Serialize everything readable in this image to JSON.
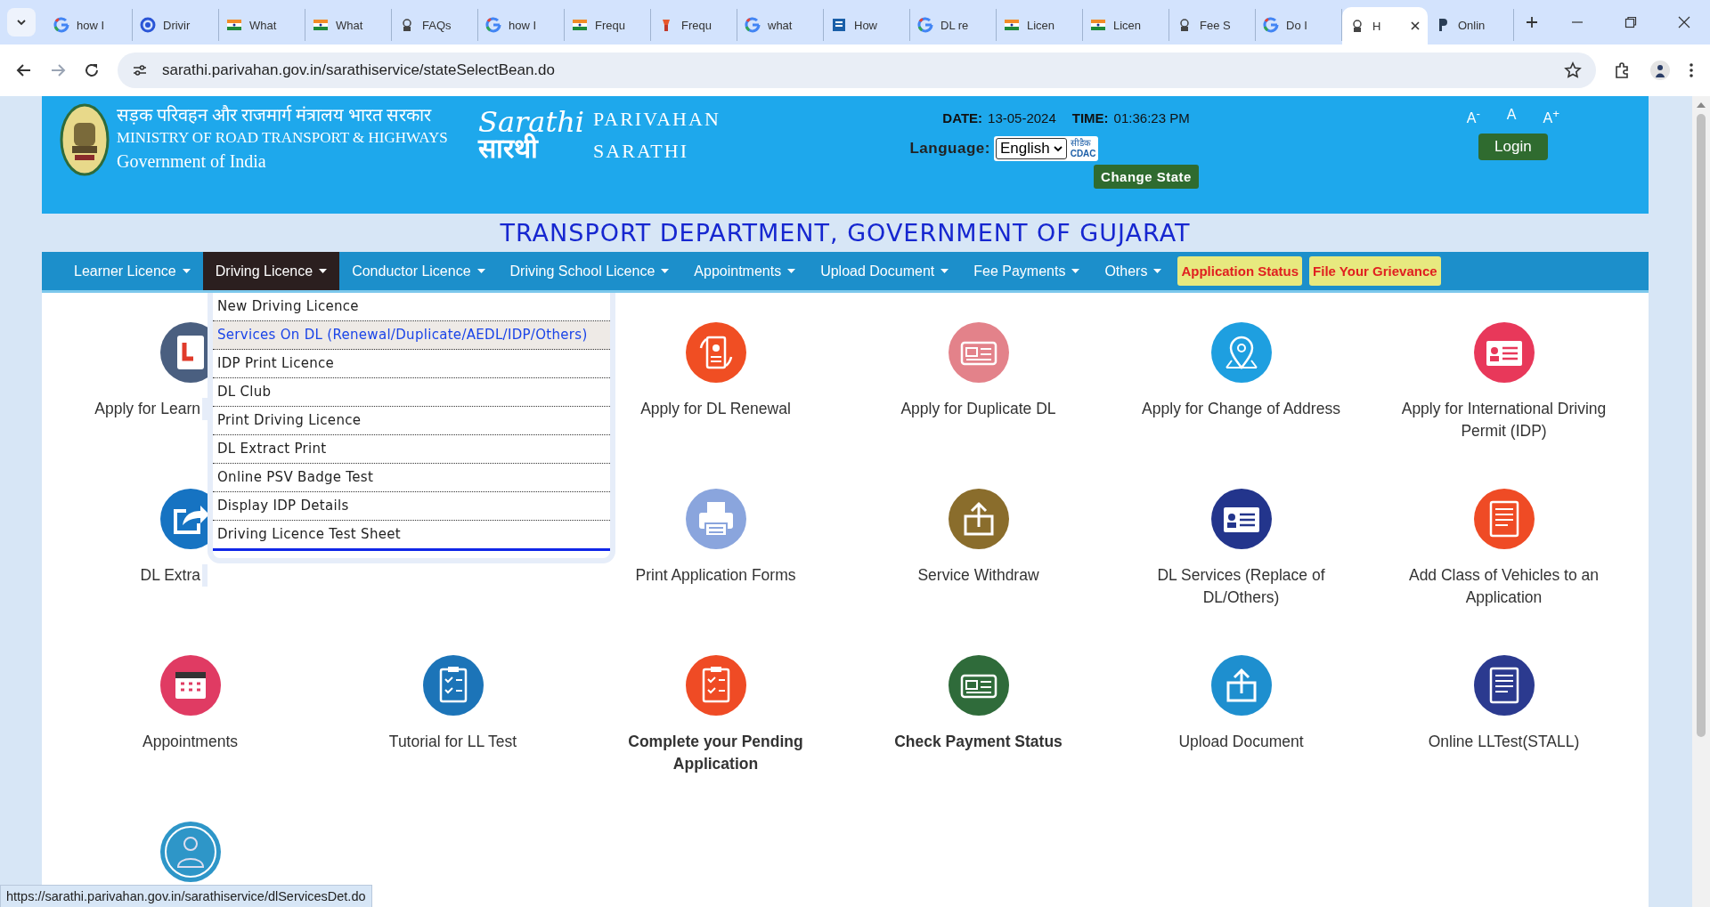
{
  "browser": {
    "tabs": [
      {
        "kind": "google",
        "title": "how I",
        "selected": false
      },
      {
        "kind": "ring",
        "title": "Drivir",
        "selected": false
      },
      {
        "kind": "flag",
        "title": "What",
        "selected": false
      },
      {
        "kind": "flag",
        "title": "What",
        "selected": false
      },
      {
        "kind": "emblem",
        "title": "FAQs",
        "selected": false
      },
      {
        "kind": "google",
        "title": "how I",
        "selected": false
      },
      {
        "kind": "flag",
        "title": "Frequ",
        "selected": false
      },
      {
        "kind": "torch",
        "title": "Frequ",
        "selected": false
      },
      {
        "kind": "google",
        "title": "what",
        "selected": false
      },
      {
        "kind": "doc",
        "title": "How",
        "selected": false
      },
      {
        "kind": "google",
        "title": "DL re",
        "selected": false
      },
      {
        "kind": "flag",
        "title": "Licen",
        "selected": false
      },
      {
        "kind": "flag",
        "title": "Licen",
        "selected": false
      },
      {
        "kind": "emblem",
        "title": "Fee S",
        "selected": false
      },
      {
        "kind": "google",
        "title": "Do I",
        "selected": false
      },
      {
        "kind": "emblem",
        "title": "H",
        "selected": true
      },
      {
        "kind": "letter",
        "title": "Onlin",
        "selected": false
      }
    ],
    "url": "sarathi.parivahan.gov.in/sarathiservice/stateSelectBean.do",
    "status_url": "https://sarathi.parivahan.gov.in/sarathiservice/dlServicesDet.do"
  },
  "header": {
    "ministry_hindi": "सड़क परिवहन और राजमार्ग मंत्रालय भारत सरकार",
    "ministry": "MINISTRY OF ROAD TRANSPORT & HIGHWAYS",
    "government": "Government of India",
    "logo_script": "Sarathi",
    "logo_hindi": "सारथी",
    "brand": [
      "PARIVAHAN",
      "SARATHI"
    ],
    "date_label": "DATE:",
    "date": "13-05-2024",
    "time_label": "TIME:",
    "time": "01:36:23 PM",
    "language_label": "Language:",
    "language": "English",
    "cdac_hindi": "सीडैक",
    "cdac": "CDAC",
    "change_state": "Change State",
    "font_sizes": [
      "A$^{-}$",
      "A",
      "A$^{+}$"
    ],
    "login": "Login"
  },
  "department": "TRANSPORT DEPARTMENT, GOVERNMENT OF GUJARAT",
  "nav": [
    {
      "kind": "menu",
      "label": "Learner Licence",
      "selected": false
    },
    {
      "kind": "menu",
      "label": "Driving Licence",
      "selected": true
    },
    {
      "kind": "menu",
      "label": "Conductor Licence",
      "selected": false
    },
    {
      "kind": "menu",
      "label": "Driving School Licence",
      "selected": false
    },
    {
      "kind": "menu",
      "label": "Appointments",
      "selected": false
    },
    {
      "kind": "menu",
      "label": "Upload Document",
      "selected": false
    },
    {
      "kind": "menu",
      "label": "Fee Payments",
      "selected": false
    },
    {
      "kind": "menu",
      "label": "Others",
      "selected": false
    },
    {
      "kind": "highlight",
      "label": "Application Status"
    },
    {
      "kind": "highlight",
      "label": "File Your Grievance"
    }
  ],
  "dropdown": [
    {
      "label": "New Driving Licence",
      "selected": false
    },
    {
      "label": "Services On DL (Renewal/Duplicate/AEDL/IDP/Others)",
      "selected": true
    },
    {
      "label": "IDP Print Licence",
      "selected": false
    },
    {
      "label": "DL Club",
      "selected": false
    },
    {
      "label": "Print Driving Licence",
      "selected": false
    },
    {
      "label": "DL Extract Print",
      "selected": false
    },
    {
      "label": "Online PSV Badge Test",
      "selected": false
    },
    {
      "label": "Display IDP Details",
      "selected": false
    },
    {
      "label": "Driving Licence Test Sheet",
      "selected": false
    }
  ],
  "services": [
    {
      "kind": "learner",
      "label": "Apply for Learn",
      "color": "#4a5f80",
      "bold": false,
      "cut": true
    },
    {
      "kind": "covered"
    },
    {
      "kind": "renewal",
      "label": "Apply for DL Renewal",
      "color": "#f04e23",
      "bold": false,
      "cut": false
    },
    {
      "kind": "card",
      "label": "Apply for Duplicate DL",
      "color": "#e3828a",
      "bold": false,
      "cut": false
    },
    {
      "kind": "pin",
      "label": "Apply for Change of Address",
      "color": "#1e9fe0",
      "bold": false,
      "cut": false
    },
    {
      "kind": "idcard",
      "label": "Apply for International Driving Permit (IDP)",
      "color": "#e8385a",
      "bold": false,
      "cut": false
    },
    {
      "kind": "share",
      "label": "DL Extra",
      "color": "#1673c2",
      "bold": false,
      "cut": true
    },
    {
      "kind": "covered"
    },
    {
      "kind": "printer",
      "label": "Print Application Forms",
      "color": "#8aa5dd",
      "bold": false,
      "cut": false
    },
    {
      "kind": "upload",
      "label": "Service Withdraw",
      "color": "#8a6d2c",
      "bold": false,
      "cut": false
    },
    {
      "kind": "idcard",
      "label": "DL Services (Replace of DL/Others)",
      "color": "#23358c",
      "bold": false,
      "cut": false
    },
    {
      "kind": "list",
      "label": "Add Class of Vehicles to an Application",
      "color": "#ef4b25",
      "bold": false,
      "cut": false
    },
    {
      "kind": "calendar",
      "label": "Appointments",
      "color": "#e03b63",
      "bold": false,
      "cut": false
    },
    {
      "kind": "checklist",
      "label": "Tutorial for LL Test",
      "color": "#1c74b8",
      "bold": false,
      "cut": false
    },
    {
      "kind": "checklist",
      "label": "Complete your Pending Application",
      "color": "#ef4b25",
      "bold": true,
      "cut": false
    },
    {
      "kind": "card",
      "label": "Check Payment Status",
      "color": "#2f6b3a",
      "bold": true,
      "cut": false
    },
    {
      "kind": "upload",
      "label": "Upload Document",
      "color": "#1e8fcf",
      "bold": false,
      "cut": false
    },
    {
      "kind": "list",
      "label": "Online LLTest(STALL)",
      "color": "#2b3a8f",
      "bold": false,
      "cut": false
    },
    {
      "kind": "doctor",
      "color": "#2e96c8"
    }
  ]
}
